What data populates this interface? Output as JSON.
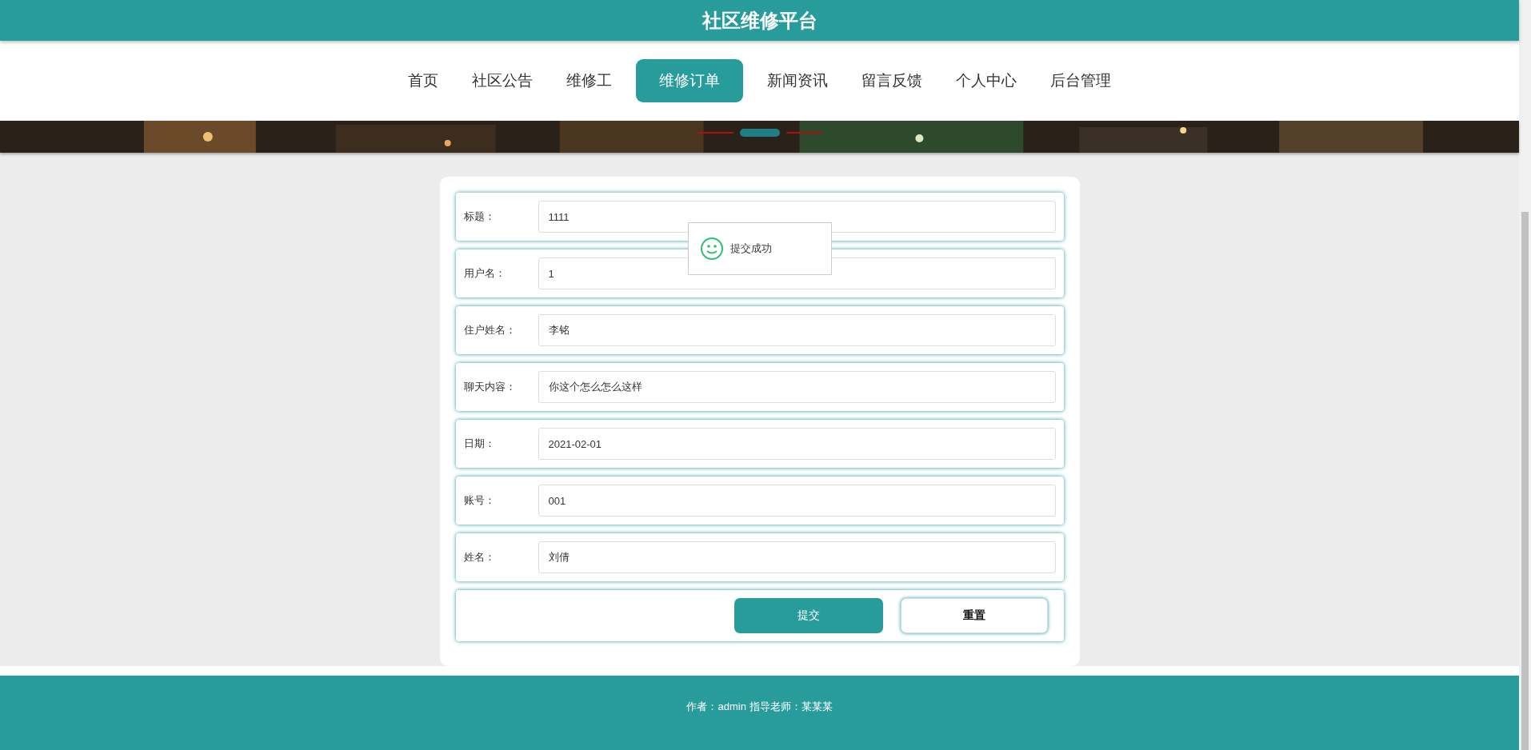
{
  "header": {
    "title": "社区维修平台"
  },
  "nav": [
    {
      "label": "首页",
      "selected": false
    },
    {
      "label": "社区公告",
      "selected": false
    },
    {
      "label": "维修工",
      "selected": false
    },
    {
      "label": "维修订单",
      "selected": true
    },
    {
      "label": "新闻资讯",
      "selected": false
    },
    {
      "label": "留言反馈",
      "selected": false
    },
    {
      "label": "个人中心",
      "selected": false
    },
    {
      "label": "后台管理",
      "selected": false
    }
  ],
  "banner": {
    "kind": "picture",
    "indicators": [
      {
        "selected": false
      },
      {
        "selected": true
      },
      {
        "selected": false
      }
    ]
  },
  "form": {
    "fields": [
      {
        "label": "标题：",
        "value": "1111"
      },
      {
        "label": "用户名：",
        "value": "1"
      },
      {
        "label": "住户姓名：",
        "value": "李铭"
      },
      {
        "label": "聊天内容：",
        "value": "你这个怎么怎么这样"
      },
      {
        "label": "日期：",
        "value": "2021-02-01"
      },
      {
        "label": "账号：",
        "value": "001"
      },
      {
        "label": "姓名：",
        "value": "刘倩"
      }
    ],
    "buttons": [
      {
        "label": "提交",
        "kind": "primary"
      },
      {
        "label": "重置",
        "kind": "secondary"
      }
    ]
  },
  "toast": {
    "message": "提交成功"
  },
  "footer": {
    "text": "作者：admin 指导老师：某某某"
  }
}
